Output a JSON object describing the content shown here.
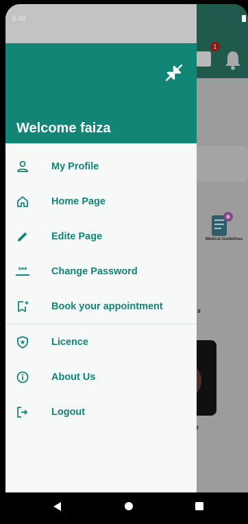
{
  "status_bar": {
    "time": "6:49"
  },
  "background_app": {
    "notification_count": "1",
    "guide_label": "Medical Guidelines",
    "fragment_1": "s",
    "fragment_2": "ce"
  },
  "drawer": {
    "welcome": "Welcome faiza",
    "collapse_icon": "collapse-arrows-icon",
    "items": [
      {
        "label": "My Profile",
        "icon": "person-icon"
      },
      {
        "label": "Home Page",
        "icon": "home-icon"
      },
      {
        "label": "Edite Page",
        "icon": "pencil-icon"
      },
      {
        "label": "Change Password",
        "icon": "password-icon"
      },
      {
        "label": "Book your appointment",
        "icon": "bookmark-add-icon"
      }
    ],
    "items_secondary": [
      {
        "label": "Licence",
        "icon": "shield-star-icon"
      },
      {
        "label": "About Us",
        "icon": "info-icon"
      },
      {
        "label": "Logout",
        "icon": "logout-icon"
      }
    ]
  },
  "colors": {
    "accent": "#128576",
    "header_bg": "#128576",
    "drawer_bg": "#f7f8f8"
  }
}
